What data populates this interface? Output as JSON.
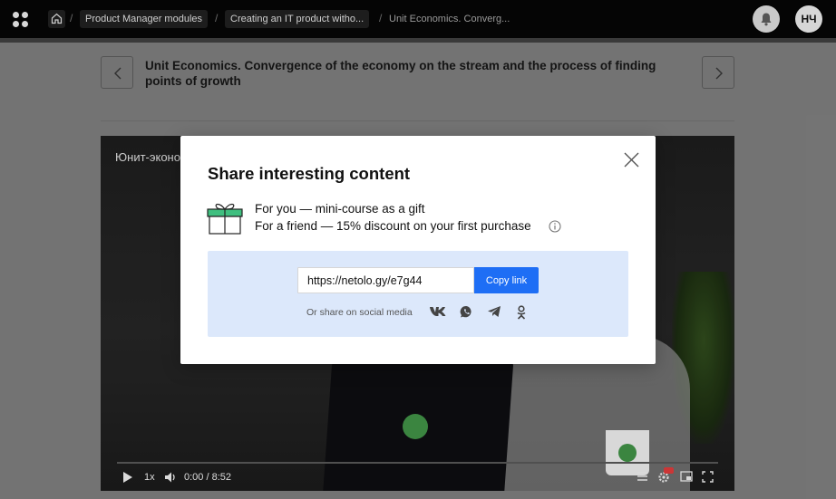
{
  "topbar": {
    "breadcrumbs": [
      {
        "label": "Product Manager modules"
      },
      {
        "label": "Creating an IT product witho..."
      },
      {
        "label": "Unit Economics. Converg..."
      }
    ],
    "separator": "/",
    "avatar_initials": "НЧ"
  },
  "lesson": {
    "title": "Unit Economics. Convergence of the economy on the stream and the process of finding points of growth"
  },
  "video": {
    "caption": "Юнит-эконо",
    "speed": "1x",
    "time": "0:00 / 8:52",
    "progress": 0.0
  },
  "modal": {
    "title": "Share interesting content",
    "offer_you": "For you — mini-course as a gift",
    "offer_friend": "For a friend — 15% discount on your first purchase",
    "link_value": "https://netolo.gy/e7g44",
    "copy_label": "Copy link",
    "share_label": "Or share on social media",
    "social": [
      "vk-icon",
      "whatsapp-icon",
      "telegram-icon",
      "odnoklassniki-icon"
    ]
  },
  "colors": {
    "accent": "#1e6ef5",
    "share_bg": "#dce8fb",
    "gift_green": "#3fbf7f"
  }
}
